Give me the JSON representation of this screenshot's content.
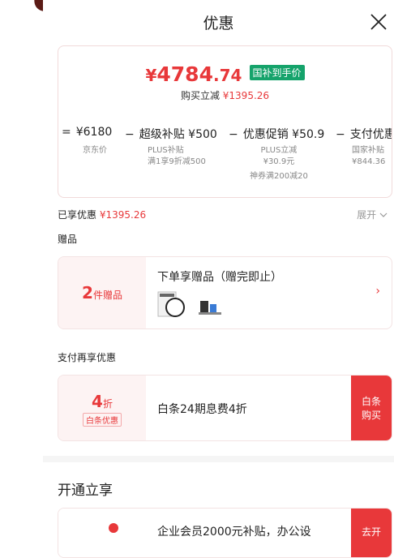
{
  "header": {
    "title": "优惠"
  },
  "price": {
    "currency": "¥",
    "integer": "4784",
    "decimal": ".74",
    "badge": "国补到手价",
    "reduce_label": "购买立减",
    "reduce_value": "¥1395.26"
  },
  "formula": [
    {
      "op": "=",
      "label": "¥6180",
      "subs": [
        "京东价"
      ]
    },
    {
      "op": "−",
      "label": "超级补贴 ¥500",
      "subs": [
        "PLUS补贴",
        "满1享9折减500"
      ]
    },
    {
      "op": "−",
      "label": "优惠促销 ¥50.9",
      "subs": [
        "PLUS立减",
        "¥30.9元",
        "神券满200减20"
      ]
    },
    {
      "op": "−",
      "label": "支付优惠",
      "subs": [
        "国家补贴",
        "¥844.36"
      ]
    }
  ],
  "enjoyed": {
    "label": "已享优惠",
    "value": "¥1395.26",
    "expand": "展开"
  },
  "gifts": {
    "section_label": "赠品",
    "count": "2",
    "count_unit": "件赠品",
    "title": "下单享赠品（赠完即止）",
    "icons": [
      "filter-ring-icon",
      "lens-accessory-icon"
    ]
  },
  "payment": {
    "section_label": "支付再享优惠",
    "discount": "4",
    "discount_unit": "折",
    "tag": "白条优惠",
    "text": "白条24期息费4折",
    "button": "白条购买"
  },
  "open": {
    "title": "开通立享",
    "member_text": "企业会员2000元补贴，办公设",
    "button": "去开"
  }
}
